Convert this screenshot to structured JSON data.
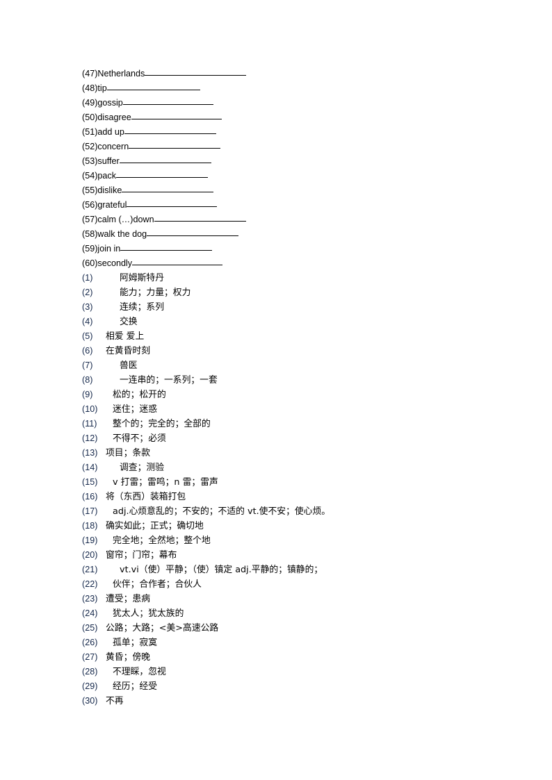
{
  "document": {
    "title": "Vocabulary Worksheet",
    "page_background": "#ffffff",
    "text_color": "#000000",
    "number_color": "#14274a"
  },
  "blank_section": {
    "name": "english-terms-with-blanks",
    "items": [
      {
        "label": "(47)Netherlands",
        "rule_width": 146
      },
      {
        "label": "(48)tip",
        "rule_width": 134
      },
      {
        "label": "(49)gossip",
        "rule_width": 130
      },
      {
        "label": "(50)disagree",
        "rule_width": 130
      },
      {
        "label": "(51)add up",
        "rule_width": 132
      },
      {
        "label": "(52)concern",
        "rule_width": 132
      },
      {
        "label": "(53)suffer",
        "rule_width": 132
      },
      {
        "label": "(54)pack",
        "rule_width": 132
      },
      {
        "label": "(55)dislike",
        "rule_width": 132
      },
      {
        "label": "(56)grateful",
        "rule_width": 130
      },
      {
        "label": "(57)calm (…)down",
        "rule_width": 132
      },
      {
        "label": "(58)walk the dog",
        "rule_width": 132
      },
      {
        "label": "(59)join in",
        "rule_width": 132
      },
      {
        "label": "(60)secondly",
        "rule_width": 130
      }
    ]
  },
  "answer_section": {
    "name": "chinese-answer-list",
    "items": [
      {
        "num": "(1)",
        "text": "阿姆斯特丹",
        "indent": 2
      },
      {
        "num": "(2)",
        "text": "能力；力量；权力",
        "indent": 2
      },
      {
        "num": "(3)",
        "text": "连续；系列",
        "indent": 2
      },
      {
        "num": "(4)",
        "text": "交换",
        "indent": 2
      },
      {
        "num": "(5)",
        "text": "相爱 爱上",
        "indent": 0
      },
      {
        "num": "(6)",
        "text": "在黄昏时刻",
        "indent": 0
      },
      {
        "num": "(7)",
        "text": "兽医",
        "indent": 2
      },
      {
        "num": "(8)",
        "text": "一连串的；一系列；一套",
        "indent": 2
      },
      {
        "num": "(9)",
        "text": "松的；松开的",
        "indent": 1
      },
      {
        "num": "(10)",
        "text": "迷住；迷惑",
        "indent": 1
      },
      {
        "num": "(11)",
        "text": "整个的；完全的；全部的",
        "indent": 1
      },
      {
        "num": "(12)",
        "text": "不得不；必须",
        "indent": 1
      },
      {
        "num": "(13)",
        "text": "项目；条款",
        "indent": 0
      },
      {
        "num": "(14)",
        "text": "调查；测验",
        "indent": 2
      },
      {
        "num": "(15)",
        "text": "v 打雷；雷鸣；n 雷；雷声",
        "indent": 1
      },
      {
        "num": "(16)",
        "text": "将（东西）装箱打包",
        "indent": 0
      },
      {
        "num": "(17)",
        "text": "adj.心烦意乱的；不安的；不适的 vt.使不安；使心烦。",
        "indent": 1
      },
      {
        "num": "(18)",
        "text": "确实如此；正式；确切地",
        "indent": 0
      },
      {
        "num": "(19)",
        "text": "完全地；全然地；整个地",
        "indent": 1
      },
      {
        "num": "(20)",
        "text": "窗帘；门帘；幕布",
        "indent": 0
      },
      {
        "num": "(21)",
        "text": "vt.vi（使）平静；（使）镇定 adj.平静的；镇静的；",
        "indent": 2
      },
      {
        "num": "(22)",
        "text": "伙伴；合作者；合伙人",
        "indent": 1
      },
      {
        "num": "(23)",
        "text": "遭受；患病",
        "indent": 0
      },
      {
        "num": "(24)",
        "text": "犹太人；犹太族的",
        "indent": 1
      },
      {
        "num": "(25)",
        "text": "公路；大路；<美>高速公路",
        "indent": 0
      },
      {
        "num": "(26)",
        "text": "孤单；寂寞",
        "indent": 1
      },
      {
        "num": "(27)",
        "text": "黄昏；傍晚",
        "indent": 0
      },
      {
        "num": "(28)",
        "text": "不理睬，忽视",
        "indent": 1
      },
      {
        "num": "(29)",
        "text": "经历；经受",
        "indent": 1
      },
      {
        "num": "(30)",
        "text": "不再",
        "indent": 0
      }
    ]
  }
}
